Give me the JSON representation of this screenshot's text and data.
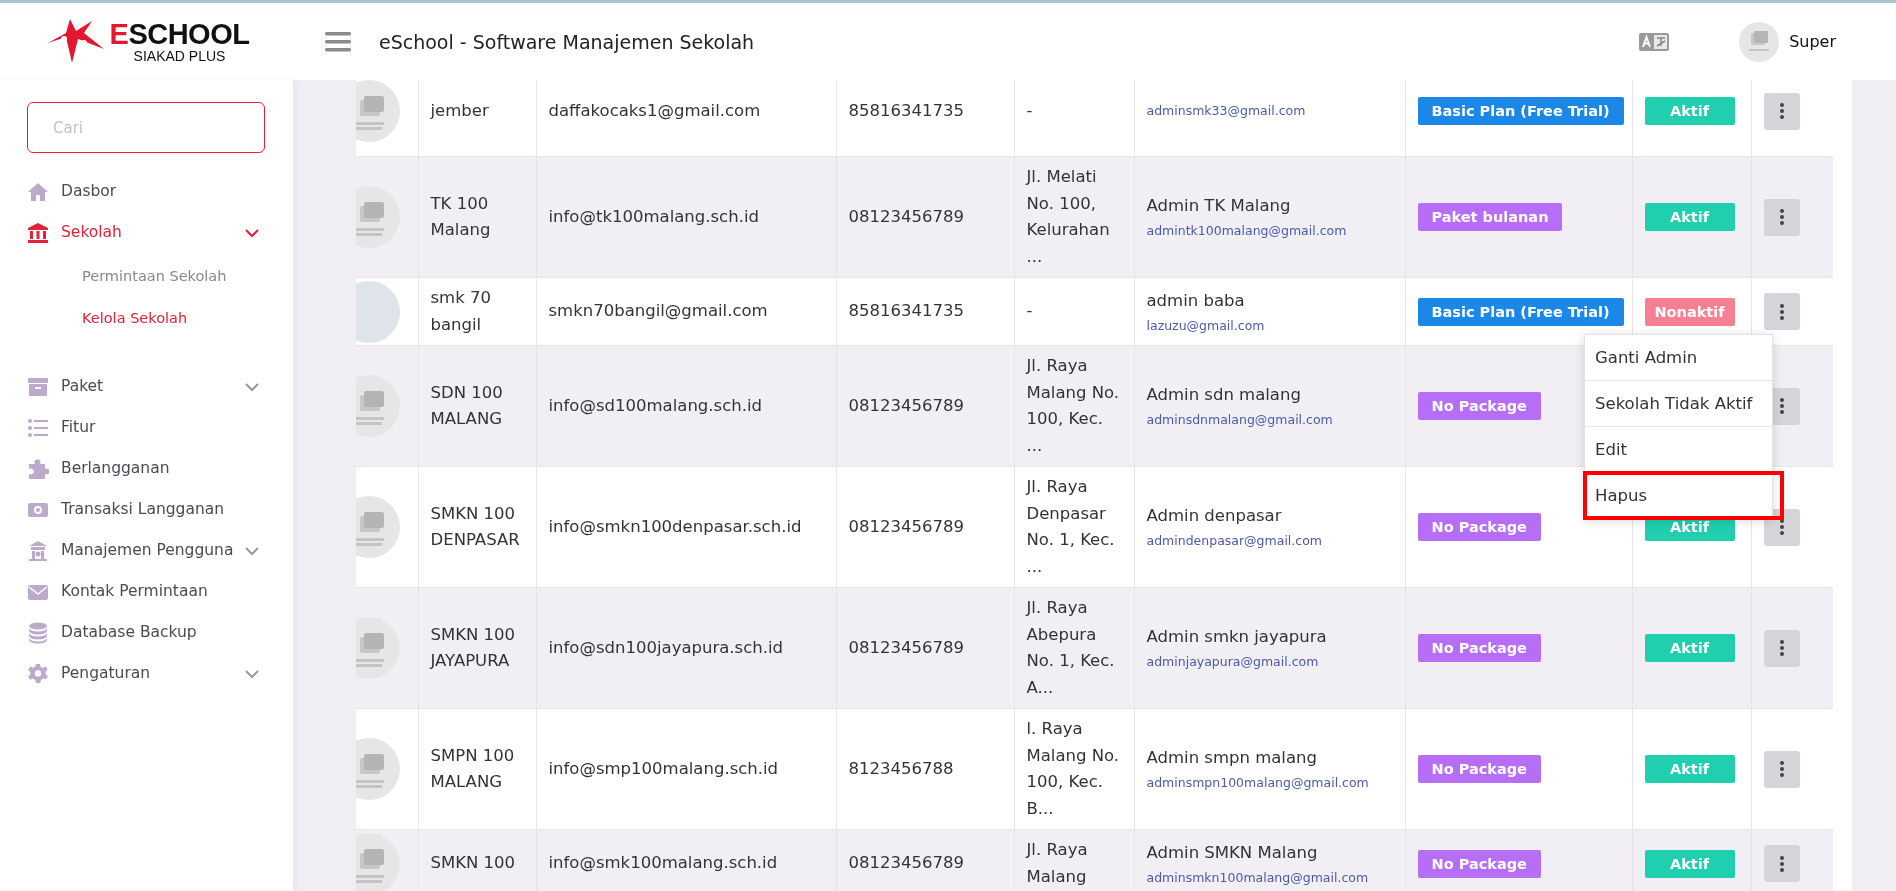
{
  "logo": {
    "title": "ESCHOOL",
    "subtitle": "SIAKAD PLUS"
  },
  "header": {
    "title": "eSchool - Software Manajemen Sekolah",
    "user": "Super"
  },
  "sidebar": {
    "search": {
      "placeholder": "Cari"
    },
    "items": [
      {
        "label": "Dasbor",
        "selected": false
      },
      {
        "label": "Sekolah",
        "selected": true,
        "has_submenu": true,
        "expanded": true,
        "children": [
          {
            "label": "Permintaan Sekolah",
            "selected": false
          },
          {
            "label": "Kelola Sekolah",
            "selected": true
          }
        ]
      },
      {
        "label": "Paket",
        "selected": false,
        "has_submenu": true
      },
      {
        "label": "Fitur",
        "selected": false
      },
      {
        "label": "Berlangganan",
        "selected": false
      },
      {
        "label": "Transaksi Langganan",
        "selected": false
      },
      {
        "label": "Manajemen Pengguna",
        "selected": false,
        "has_submenu": true
      },
      {
        "label": "Kontak Permintaan",
        "selected": false
      },
      {
        "label": "Database Backup",
        "selected": false
      },
      {
        "label": "Pengaturan",
        "selected": false,
        "has_submenu": true
      }
    ]
  },
  "table": {
    "rows": [
      {
        "has_logo_image": false,
        "name": "jember",
        "email": "daffakocaks1@gmail.com",
        "phone": "85816341735",
        "address": "-",
        "admin_email": "adminsmk33@gmail.com",
        "package": {
          "label": "Basic Plan (Free Trial)",
          "color": "#1b87e6"
        },
        "status": {
          "label": "Aktif",
          "active": true
        }
      },
      {
        "has_logo_image": false,
        "name": "TK 100 Malang",
        "email": "info@tk100malang.sch.id",
        "phone": "08123456789",
        "address": "Jl. Melati No. 100, Kelurahan ...",
        "admin_name": "Admin TK Malang",
        "admin_email": "admintk100malang@gmail.com",
        "package": {
          "label": "Paket bulanan",
          "color": "#b66ef7"
        },
        "status": {
          "label": "Aktif",
          "active": true
        }
      },
      {
        "has_logo_image": true,
        "name": "smk 70 bangil",
        "email": "smkn70bangil@gmail.com",
        "phone": "85816341735",
        "address": "-",
        "admin_name": "admin baba",
        "admin_email": "lazuzu@gmail.com",
        "package": {
          "label": "Basic Plan (Free Trial)",
          "color": "#1b87e6"
        },
        "status": {
          "label": "Nonaktif",
          "active": false
        },
        "menu": [
          {
            "label": "Ganti Admin",
            "highlighted": false
          },
          {
            "label": "Sekolah Tidak Aktif",
            "highlighted": false
          },
          {
            "label": "Edit",
            "highlighted": false
          },
          {
            "label": "Hapus",
            "highlighted": true
          }
        ]
      },
      {
        "has_logo_image": false,
        "name": "SDN 100 MALANG",
        "email": "info@sd100malang.sch.id",
        "phone": "08123456789",
        "address": "Jl. Raya Malang No. 100, Kec. ...",
        "admin_name": "Admin sdn malang",
        "admin_email": "adminsdnmalang@gmail.com",
        "package": {
          "label": "No Package",
          "color": "#b66ef7"
        }
      },
      {
        "has_logo_image": false,
        "name": "SMKN 100 DENPASAR",
        "email": "info@smkn100denpasar.sch.id",
        "phone": "08123456789",
        "address": "Jl. Raya Denpasar No. 1, Kec. ...",
        "admin_name": "Admin denpasar",
        "admin_email": "admindenpasar@gmail.com",
        "package": {
          "label": "No Package",
          "color": "#b66ef7"
        },
        "status": {
          "label": "Aktif",
          "active": true
        }
      },
      {
        "has_logo_image": false,
        "name": "SMKN 100 JAYAPURA",
        "email": "info@sdn100jayapura.sch.id",
        "phone": "08123456789",
        "address": "Jl. Raya Abepura No. 1, Kec. A...",
        "admin_name": "Admin smkn jayapura",
        "admin_email": "adminjayapura@gmail.com",
        "package": {
          "label": "No Package",
          "color": "#b66ef7"
        },
        "status": {
          "label": "Aktif",
          "active": true
        }
      },
      {
        "has_logo_image": false,
        "name": "SMPN 100 MALANG",
        "email": "info@smp100malang.sch.id",
        "phone": "8123456788",
        "address": "l. Raya Malang No. 100, Kec. B...",
        "admin_name": "Admin smpn malang",
        "admin_email": "adminsmpn100malang@gmail.com",
        "package": {
          "label": "No Package",
          "color": "#b66ef7"
        },
        "status": {
          "label": "Aktif",
          "active": true
        }
      },
      {
        "has_logo_image": false,
        "name": "SMKN 100",
        "email": "info@smk100malang.sch.id",
        "phone": "08123456789",
        "address": "Jl. Raya Malang",
        "admin_name": "Admin SMKN Malang",
        "admin_email": "adminsmkn100malang@gmail.com",
        "package": {
          "label": "No Package",
          "color": "#b66ef7"
        },
        "status": {
          "label": "Aktif",
          "active": true
        }
      }
    ]
  }
}
